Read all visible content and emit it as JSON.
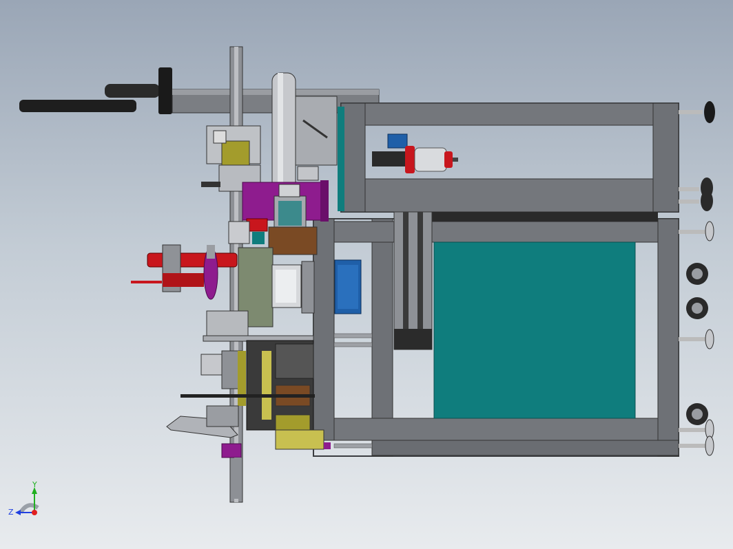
{
  "viewport": {
    "background_top": "#9aa6b6",
    "background_bottom": "#e8ebee"
  },
  "triad": {
    "x_label": "",
    "y_label": "Y",
    "z_label": "Z",
    "x_color": "#e02020",
    "y_color": "#20b020",
    "z_color": "#2040e0"
  },
  "palette": {
    "frame": "#6e7176",
    "frame_dark": "#3a3c40",
    "teal_panel": "#0f7d7d",
    "magenta": "#8e1c8e",
    "red_roller": "#c8161d",
    "blue_motor": "#1f5fa8",
    "olive": "#a39c2c",
    "dark_steel": "#262626",
    "light_steel": "#b9bdc2"
  }
}
